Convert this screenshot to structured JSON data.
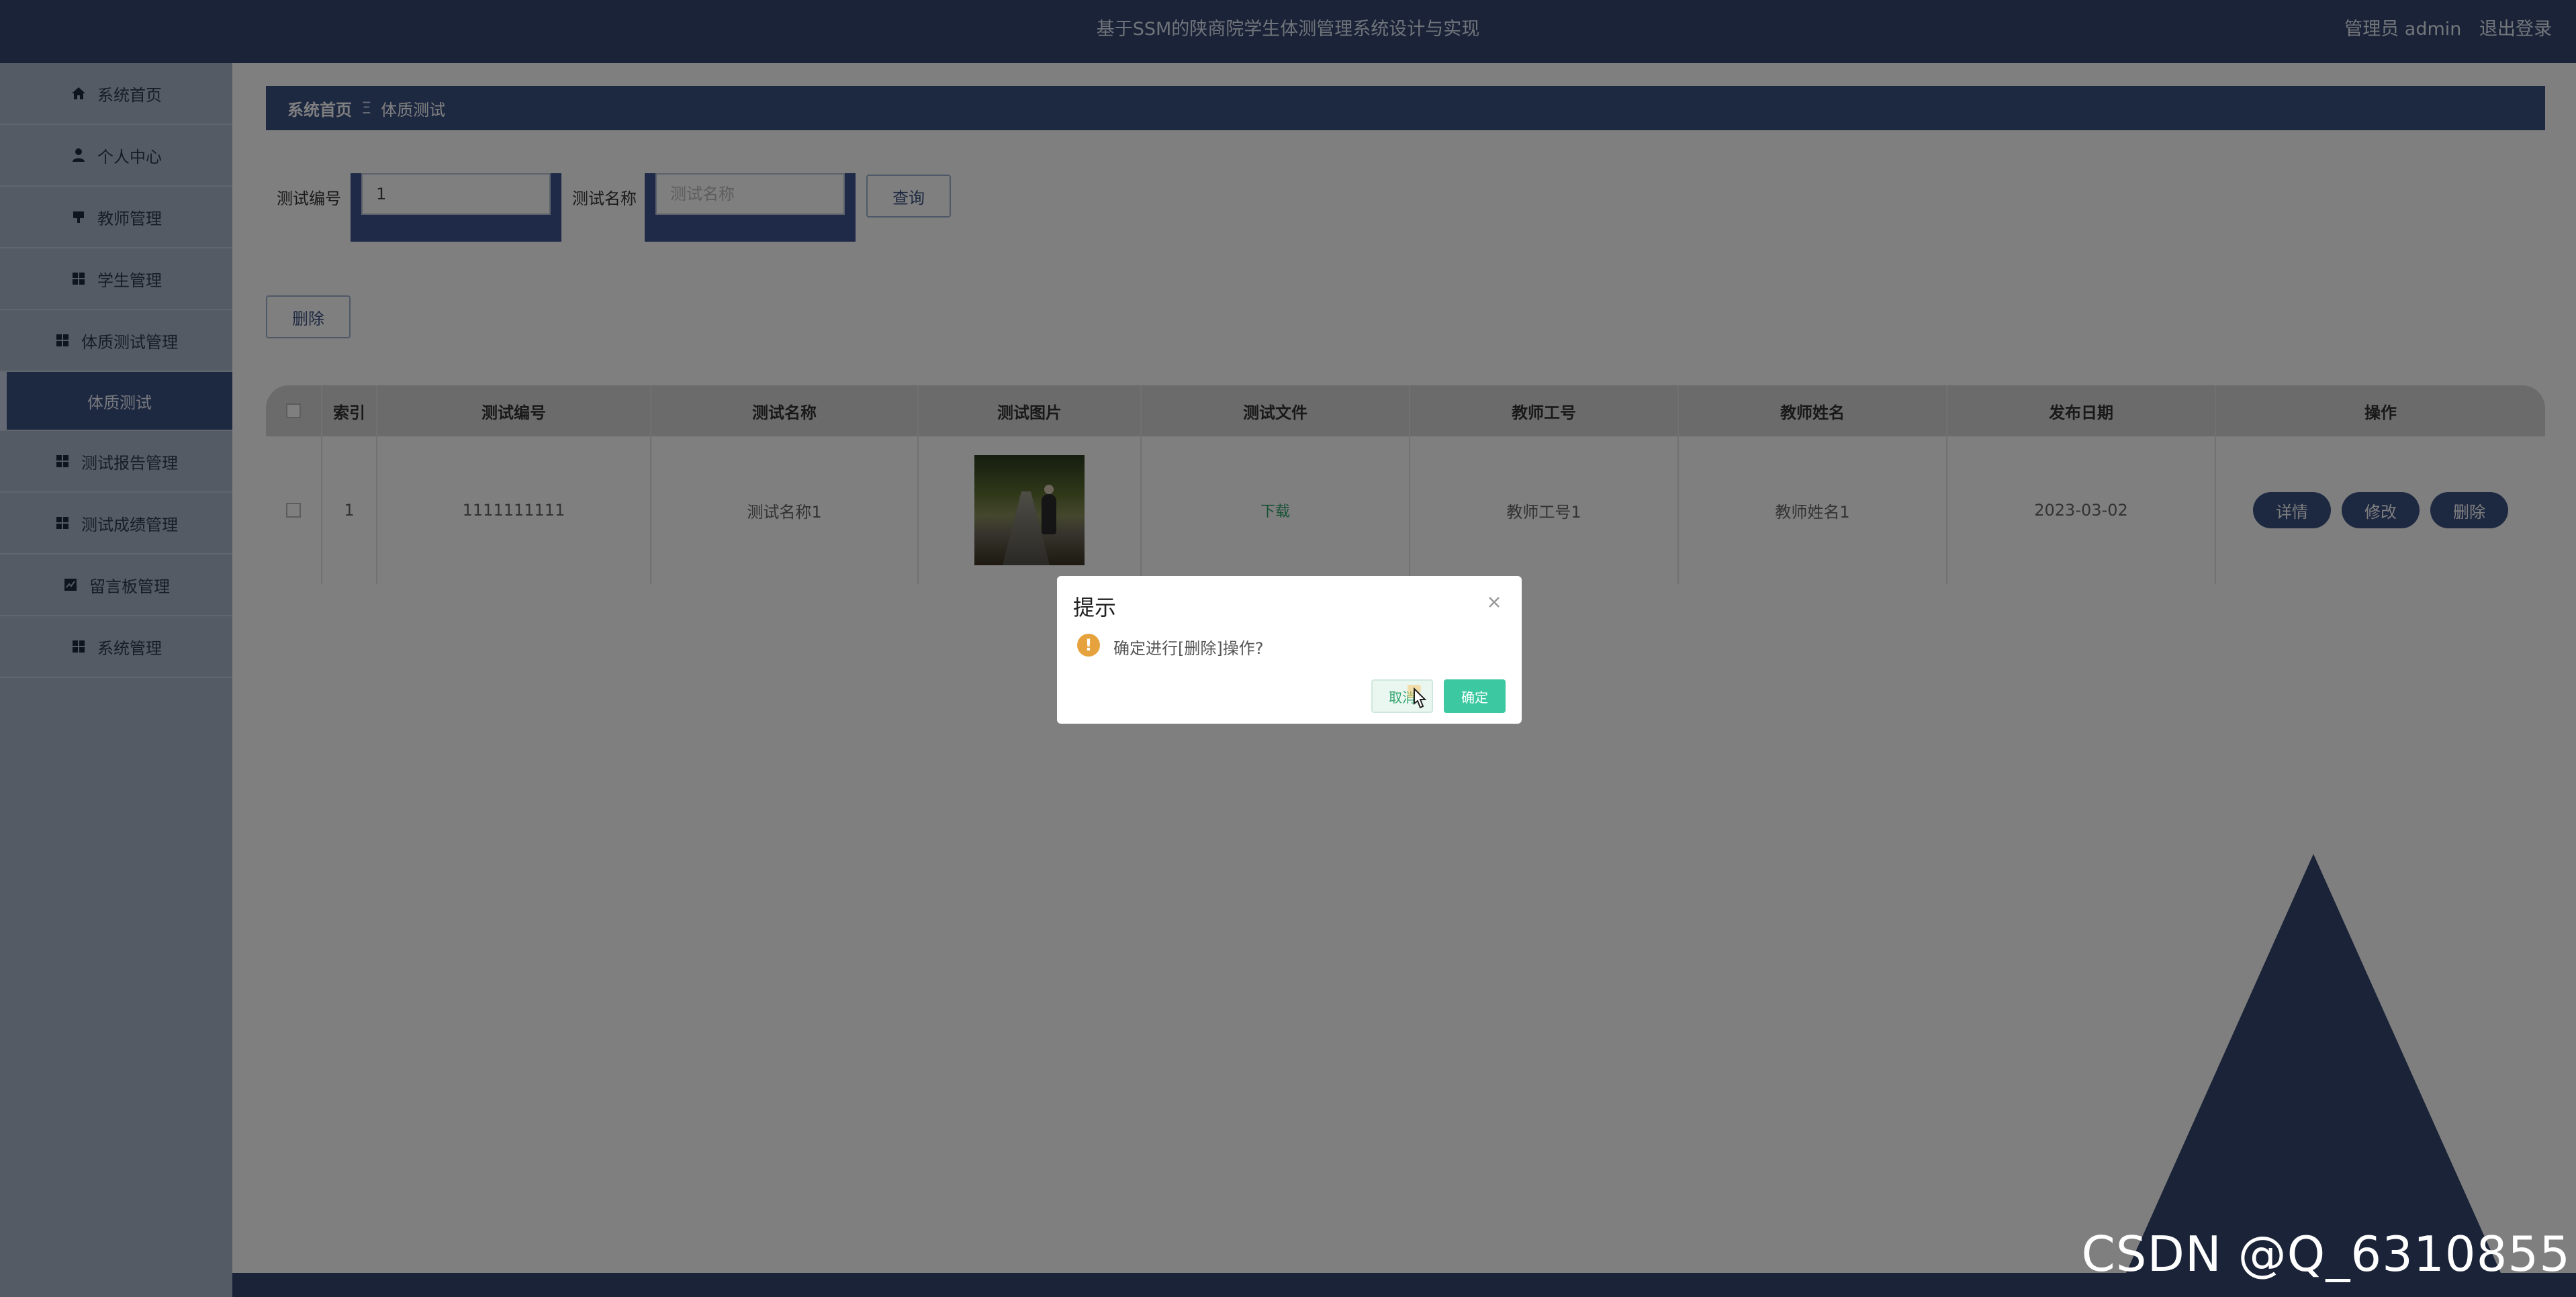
{
  "header": {
    "app_title": "基于SSM的陕商院学生体测管理系统设计与实现",
    "user_label": "管理员 admin",
    "logout_label": "退出登录"
  },
  "sidebar": {
    "items": [
      {
        "label": "系统首页",
        "icon": "home-icon"
      },
      {
        "label": "个人中心",
        "icon": "user-icon"
      },
      {
        "label": "教师管理",
        "icon": "teacher-icon"
      },
      {
        "label": "学生管理",
        "icon": "grid-icon"
      },
      {
        "label": "体质测试管理",
        "icon": "grid-icon"
      },
      {
        "label": "体质测试",
        "icon": "",
        "active": true
      },
      {
        "label": "测试报告管理",
        "icon": "grid-icon"
      },
      {
        "label": "测试成绩管理",
        "icon": "grid-icon"
      },
      {
        "label": "留言板管理",
        "icon": "chart-icon"
      },
      {
        "label": "系统管理",
        "icon": "grid-icon"
      }
    ]
  },
  "breadcrumb": {
    "home": "系统首页",
    "separator": "Ξ",
    "current": "体质测试"
  },
  "search": {
    "code_label": "测试编号",
    "code_value": "1",
    "name_label": "测试名称",
    "name_placeholder": "测试名称",
    "query_button": "查询"
  },
  "toolbar": {
    "delete_button": "删除"
  },
  "table": {
    "headers": [
      "",
      "索引",
      "测试编号",
      "测试名称",
      "测试图片",
      "测试文件",
      "教师工号",
      "教师姓名",
      "发布日期",
      "操作"
    ],
    "rows": [
      {
        "index": "1",
        "code": "1111111111",
        "name": "测试名称1",
        "file_link": "下载",
        "teacher_id": "教师工号1",
        "teacher_name": "教师姓名1",
        "date": "2023-03-02",
        "actions": [
          "详情",
          "修改",
          "删除"
        ]
      }
    ]
  },
  "dialog": {
    "title": "提示",
    "message": "确定进行[删除]操作?",
    "cancel": "取消",
    "confirm": "确定",
    "warn_glyph": "!"
  },
  "colors": {
    "primary": "#34476f",
    "accent_green": "#3cc9a1",
    "warning": "#e6a23c"
  },
  "watermark": "CSDN @Q_6310855"
}
